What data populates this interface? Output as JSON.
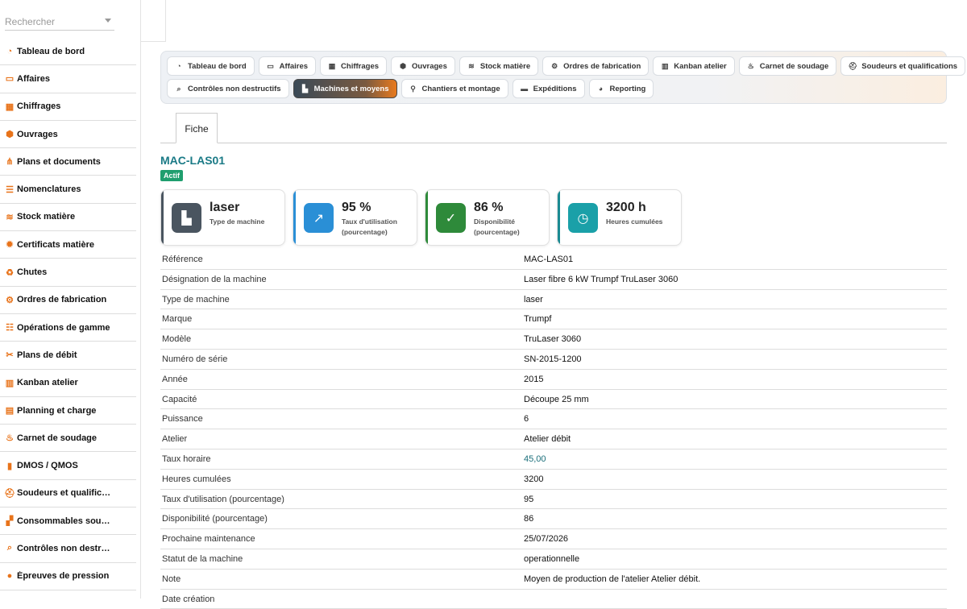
{
  "sidebar": {
    "search_placeholder": "Rechercher",
    "items": [
      {
        "label": "Tableau de bord",
        "icon": "dashboard-icon"
      },
      {
        "label": "Affaires",
        "icon": "briefcase-icon"
      },
      {
        "label": "Chiffrages",
        "icon": "calculator-icon"
      },
      {
        "label": "Ouvrages",
        "icon": "box-icon"
      },
      {
        "label": "Plans et documents",
        "icon": "sitemap-icon"
      },
      {
        "label": "Nomenclatures",
        "icon": "list-icon"
      },
      {
        "label": "Stock matière",
        "icon": "layers-icon"
      },
      {
        "label": "Certificats matière",
        "icon": "certificate-icon"
      },
      {
        "label": "Chutes",
        "icon": "recycle-icon"
      },
      {
        "label": "Ordres de fabrication",
        "icon": "cogs-icon"
      },
      {
        "label": "Opérations de gamme",
        "icon": "tasks-icon"
      },
      {
        "label": "Plans de débit",
        "icon": "scissors-icon"
      },
      {
        "label": "Kanban atelier",
        "icon": "kanban-icon"
      },
      {
        "label": "Planning et charge",
        "icon": "calendar-icon"
      },
      {
        "label": "Carnet de soudage",
        "icon": "flame-icon"
      },
      {
        "label": "DMOS / QMOS",
        "icon": "file-icon"
      },
      {
        "label": "Soudeurs et qualific…",
        "icon": "hardhat-icon"
      },
      {
        "label": "Consommables sou…",
        "icon": "boxes-icon"
      },
      {
        "label": "Contrôles non destr…",
        "icon": "magnifier-icon"
      },
      {
        "label": "Épreuves de pression",
        "icon": "droplet-icon"
      }
    ]
  },
  "tabs": {
    "row1": [
      {
        "label": "Tableau de bord",
        "icon": "dashboard-icon"
      },
      {
        "label": "Affaires",
        "icon": "briefcase-icon"
      },
      {
        "label": "Chiffrages",
        "icon": "calculator-icon"
      },
      {
        "label": "Ouvrages",
        "icon": "box-icon"
      },
      {
        "label": "Stock matière",
        "icon": "layers-icon"
      },
      {
        "label": "Ordres de fabrication",
        "icon": "cogs-icon"
      },
      {
        "label": "Kanban atelier",
        "icon": "kanban-icon"
      },
      {
        "label": "Carnet de soudage",
        "icon": "flame-icon"
      },
      {
        "label": "Soudeurs et qualifications",
        "icon": "hardhat-icon"
      }
    ],
    "row2": [
      {
        "label": "Contrôles non destructifs",
        "icon": "magnifier-icon"
      },
      {
        "label": "Machines et moyens",
        "icon": "factory-icon",
        "active": true
      },
      {
        "label": "Chantiers et montage",
        "icon": "pin-icon"
      },
      {
        "label": "Expéditions",
        "icon": "truck-icon"
      },
      {
        "label": "Reporting",
        "icon": "chart-pie-icon"
      }
    ]
  },
  "subtab": {
    "label": "Fiche"
  },
  "record": {
    "title": "MAC-LAS01",
    "status": "Actif"
  },
  "kpis": [
    {
      "value": "laser",
      "label": "Type de machine",
      "icon": "factory-icon",
      "color": "#4a5560",
      "bar": "#4a5560"
    },
    {
      "value": "95 %",
      "label": "Taux d'utilisation (pourcentage)",
      "icon": "chart-line-icon",
      "color": "#2a8fd6",
      "bar": "#2a8fd6"
    },
    {
      "value": "86 %",
      "label": "Disponibilité (pourcentage)",
      "icon": "check-circle-icon",
      "color": "#2e8a3a",
      "bar": "#2e8a3a"
    },
    {
      "value": "3200 h",
      "label": "Heures cumulées",
      "icon": "clock-icon",
      "color": "#1aa0a8",
      "bar": "#1a8a92"
    }
  ],
  "fields": [
    {
      "key": "Référence",
      "value": "MAC-LAS01"
    },
    {
      "key": "Désignation de la machine",
      "value": "Laser fibre 6 kW Trumpf TruLaser 3060"
    },
    {
      "key": "Type de machine",
      "value": "laser"
    },
    {
      "key": "Marque",
      "value": "Trumpf"
    },
    {
      "key": "Modèle",
      "value": "TruLaser 3060"
    },
    {
      "key": "Numéro de série",
      "value": "SN-2015-1200"
    },
    {
      "key": "Année",
      "value": "2015"
    },
    {
      "key": "Capacité",
      "value": "Découpe 25 mm"
    },
    {
      "key": "Puissance",
      "value": "6"
    },
    {
      "key": "Atelier",
      "value": "Atelier débit"
    },
    {
      "key": "Taux horaire",
      "value": "45,00",
      "link": true
    },
    {
      "key": "Heures cumulées",
      "value": "3200"
    },
    {
      "key": "Taux d'utilisation (pourcentage)",
      "value": "95"
    },
    {
      "key": "Disponibilité (pourcentage)",
      "value": "86"
    },
    {
      "key": "Prochaine maintenance",
      "value": "25/07/2026"
    },
    {
      "key": "Statut de la machine",
      "value": "operationnelle"
    },
    {
      "key": "Note",
      "value": "Moyen de production de l'atelier Atelier débit."
    },
    {
      "key": "Date création",
      "value": ""
    }
  ]
}
